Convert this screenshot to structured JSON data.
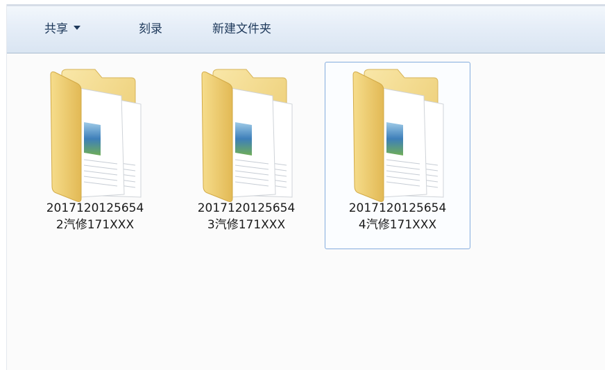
{
  "toolbar": {
    "share_label": "共享",
    "burn_label": "刻录",
    "new_folder_label": "新建文件夹"
  },
  "icons": {
    "share_dropdown": "chevron-down-icon",
    "folder": "folder-with-documents-icon"
  },
  "colors": {
    "toolbar_text": "#1e395b",
    "selection_border": "#84acdd",
    "folder_yellow": "#f0d27a"
  },
  "files": [
    {
      "line1": "2017120125654",
      "line2": "2汽修171XXX",
      "selected": false
    },
    {
      "line1": "2017120125654",
      "line2": "3汽修171XXX",
      "selected": false
    },
    {
      "line1": "2017120125654",
      "line2": "4汽修171XXX",
      "selected": true
    }
  ]
}
